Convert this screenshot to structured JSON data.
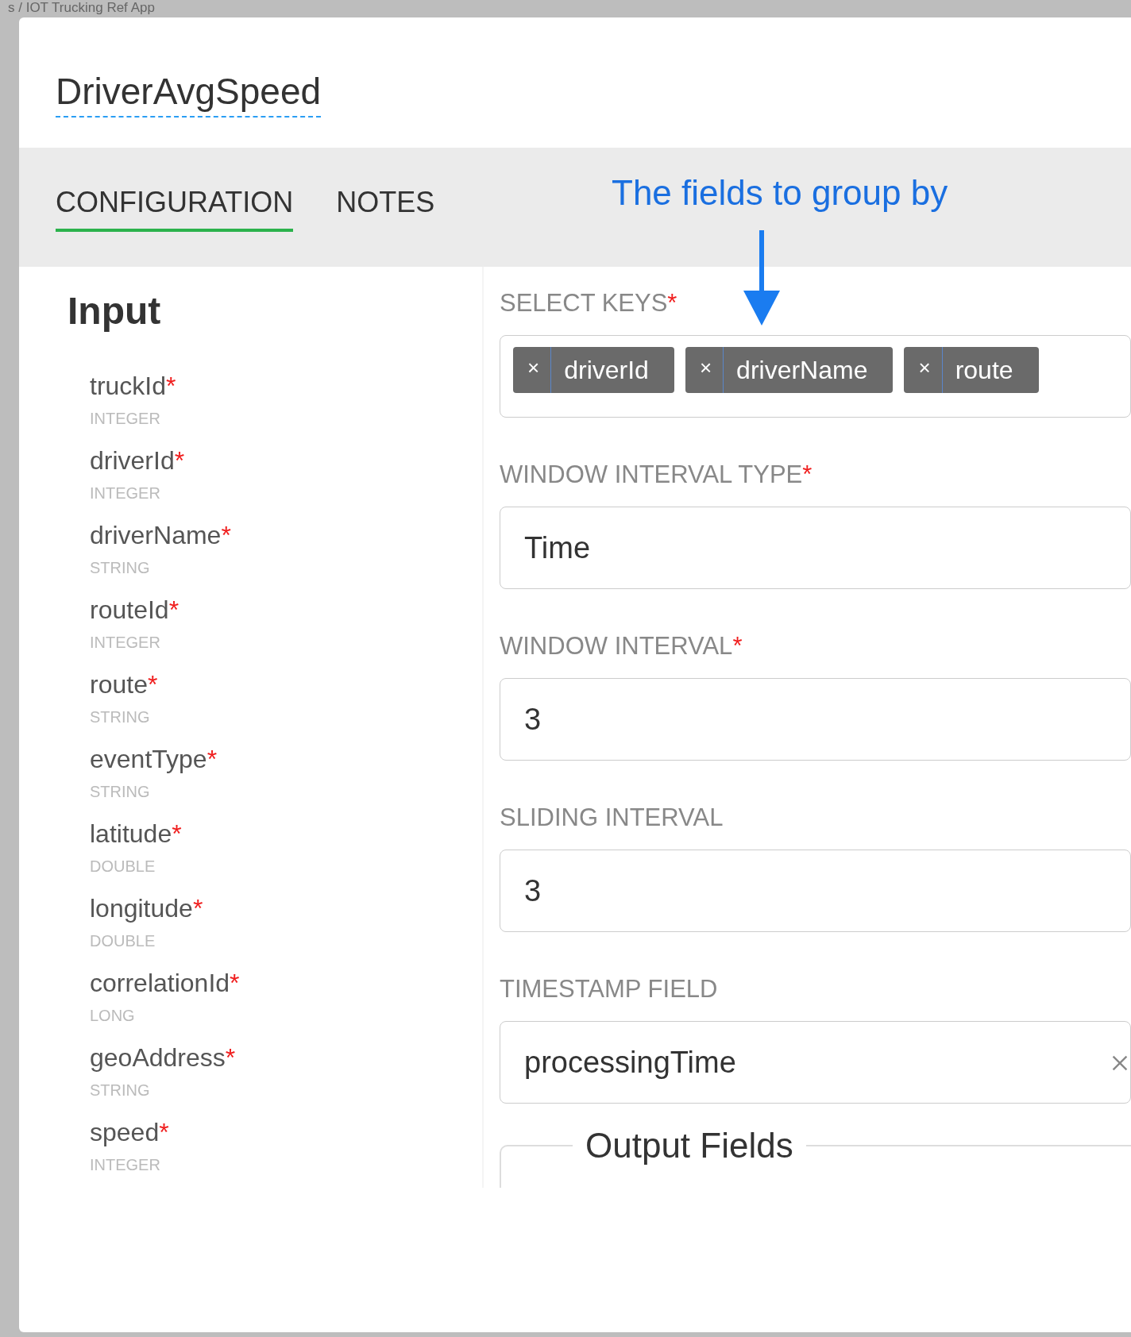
{
  "background": {
    "breadcrumb": "s / IOT Trucking Ref App"
  },
  "dialog": {
    "title": "DriverAvgSpeed",
    "tabs": [
      {
        "label": "CONFIGURATION",
        "selected": true
      },
      {
        "label": "NOTES",
        "selected": false
      }
    ],
    "annotation": {
      "text": "The fields to group by"
    },
    "input": {
      "heading": "Input",
      "fields": [
        {
          "name": "truckId",
          "required_mark": "*",
          "type": "INTEGER"
        },
        {
          "name": "driverId",
          "required_mark": "*",
          "type": "INTEGER"
        },
        {
          "name": "driverName",
          "required_mark": "*",
          "type": "STRING"
        },
        {
          "name": "routeId",
          "required_mark": "*",
          "type": "INTEGER"
        },
        {
          "name": "route",
          "required_mark": "*",
          "type": "STRING"
        },
        {
          "name": "eventType",
          "required_mark": "*",
          "type": "STRING"
        },
        {
          "name": "latitude",
          "required_mark": "*",
          "type": "DOUBLE"
        },
        {
          "name": "longitude",
          "required_mark": "*",
          "type": "DOUBLE"
        },
        {
          "name": "correlationId",
          "required_mark": "*",
          "type": "LONG"
        },
        {
          "name": "geoAddress",
          "required_mark": "*",
          "type": "STRING"
        },
        {
          "name": "speed",
          "required_mark": "*",
          "type": "INTEGER"
        }
      ]
    },
    "form": {
      "fields": [
        {
          "kind": "tags",
          "label": "SELECT KEYS",
          "required_mark": "*",
          "tags": [
            {
              "text": "driverId",
              "remove": "×"
            },
            {
              "text": "driverName",
              "remove": "×"
            },
            {
              "text": "route",
              "remove": "×"
            }
          ]
        },
        {
          "kind": "select",
          "label": "WINDOW INTERVAL TYPE",
          "required_mark": "*",
          "value": "Time"
        },
        {
          "kind": "input",
          "label": "WINDOW INTERVAL",
          "required_mark": "*",
          "value": "3"
        },
        {
          "kind": "input",
          "label": "SLIDING INTERVAL",
          "value": "3"
        },
        {
          "kind": "select",
          "label": "TIMESTAMP FIELD",
          "value": "processingTime",
          "clearable": true
        }
      ],
      "output_section": {
        "legend": "Output Fields"
      }
    }
  }
}
